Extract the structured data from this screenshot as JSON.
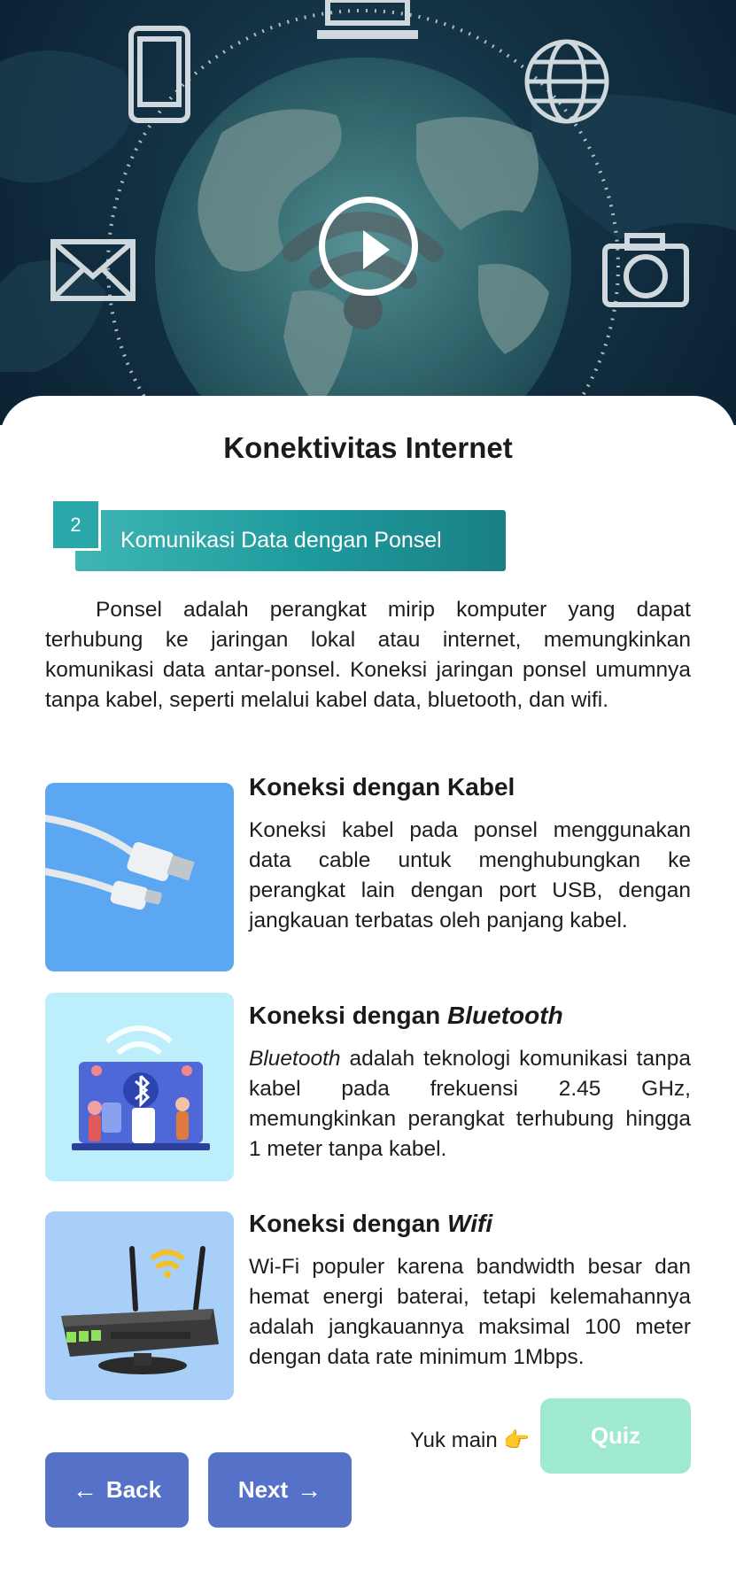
{
  "page": {
    "title": "Konektivitas Internet"
  },
  "section": {
    "number": "2",
    "label": "Komunikasi Data dengan Ponsel"
  },
  "intro": "Ponsel adalah perangkat mirip komputer yang dapat terhubung ke jaringan lokal atau internet, memungkinkan komunikasi data antar-ponsel. Koneksi jaringan ponsel umumnya tanpa kabel, seperti melalui kabel data, bluetooth, dan wifi.",
  "items": [
    {
      "title_prefix": "Koneksi dengan ",
      "title_em": "Kabel",
      "text": "Koneksi kabel pada ponsel menggunakan data cable untuk menghubungkan ke perangkat lain dengan port USB, dengan jangkauan terbatas oleh panjang kabel."
    },
    {
      "title_prefix": "Koneksi dengan ",
      "title_em": "Bluetooth",
      "text_em": "Bluetooth",
      "text": " adalah teknologi komunikasi tanpa kabel pada frekuensi 2.45 GHz, memungkinkan perangkat terhubung hingga 1 meter tanpa kabel."
    },
    {
      "title_prefix": "Koneksi dengan ",
      "title_em": "Wifi",
      "text": "Wi-Fi populer karena bandwidth besar dan hemat energi baterai, tetapi kelemahannya adalah  jangkauannya maksimal 100 meter dengan data rate minimum 1Mbps."
    }
  ],
  "quiz": {
    "prompt": "Yuk main",
    "button": "Quiz"
  },
  "nav": {
    "back_arrow": "←",
    "back": "Back",
    "next": "Next",
    "next_arrow": "→"
  },
  "icons": {
    "play": "play-icon",
    "pointer": "👉"
  },
  "colors": {
    "teal": "#2aa8a9",
    "nav_button": "#5671c8",
    "quiz_button": "#9fe9cf"
  }
}
